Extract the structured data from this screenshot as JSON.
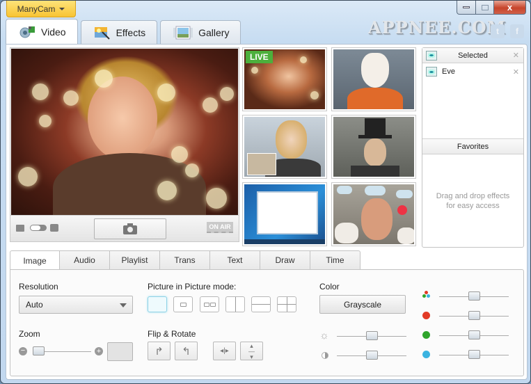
{
  "app": {
    "menu_label": "ManyCam",
    "brand_watermark": "APPNEE.COM"
  },
  "window_controls": {
    "minimize": "minimize",
    "maximize": "maximize",
    "close": "x"
  },
  "social": {
    "twitter": "t",
    "facebook": "f"
  },
  "main_tabs": [
    {
      "label": "Video",
      "icon": "webcam-icon",
      "active": true
    },
    {
      "label": "Effects",
      "icon": "effects-wand-icon",
      "active": false
    },
    {
      "label": "Gallery",
      "icon": "gallery-image-icon",
      "active": false
    }
  ],
  "preview": {
    "on_air_label": "ON AIR",
    "snapshot_icon": "camera-icon",
    "mode_toggle": [
      "video-icon",
      "toggle-switch",
      "photo-icon"
    ]
  },
  "thumbnails": [
    {
      "name": "live-webcam",
      "badge": "LIVE"
    },
    {
      "name": "cat-mask-effect"
    },
    {
      "name": "picture-in-picture"
    },
    {
      "name": "top-hat-effect"
    },
    {
      "name": "desktop-screen"
    },
    {
      "name": "rain-cloud-effect"
    }
  ],
  "selected_panel": {
    "title": "Selected",
    "items": [
      {
        "label": "Eve"
      }
    ]
  },
  "favorites_panel": {
    "title": "Favorites",
    "empty_text_line1": "Drag and drop effects",
    "empty_text_line2": "for easy access"
  },
  "bottom_tabs": [
    {
      "label": "Image",
      "active": true
    },
    {
      "label": "Audio"
    },
    {
      "label": "Playlist"
    },
    {
      "label": "Trans"
    },
    {
      "label": "Text"
    },
    {
      "label": "Draw"
    },
    {
      "label": "Time"
    }
  ],
  "image_panel": {
    "resolution_label": "Resolution",
    "resolution_value": "Auto",
    "pip_label": "Picture in Picture mode:",
    "pip_modes": [
      "off",
      "small-inset",
      "dual-inset",
      "split-vertical",
      "split-horizontal",
      "quad"
    ],
    "pip_selected": "off",
    "zoom_label": "Zoom",
    "zoom_level": 0,
    "flip_label": "Flip & Rotate",
    "flip_buttons": [
      "rotate-right",
      "rotate-left",
      "flip-horizontal",
      "flip-vertical"
    ],
    "color_label": "Color",
    "grayscale_label": "Grayscale",
    "brightness": 0.5,
    "contrast": 0.5,
    "saturation": 0.5,
    "red": 0.5,
    "green": 0.5,
    "blue": 0.5
  },
  "colors": {
    "red": "#e23a26",
    "green": "#2fa52c",
    "blue": "#3bb3e0",
    "live_badge": "#4caf3c",
    "menu_button": "#f8c433"
  }
}
